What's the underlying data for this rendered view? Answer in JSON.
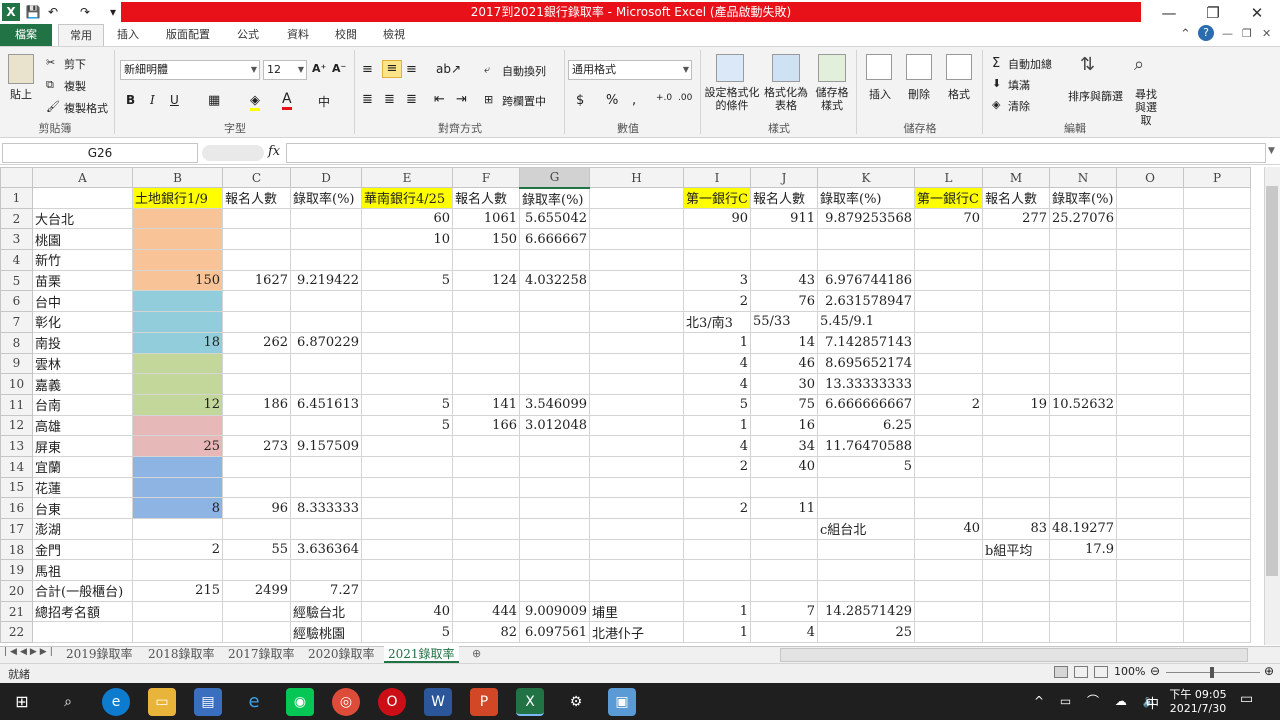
{
  "window": {
    "title": "2017到2021銀行錄取率 - Microsoft Excel (產品啟動失敗)",
    "controls": {
      "minimize": "—",
      "restore": "❐",
      "close": "✕"
    }
  },
  "ribbon_tabs": [
    "檔案",
    "常用",
    "插入",
    "版面配置",
    "公式",
    "資料",
    "校閱",
    "檢視"
  ],
  "ribbon": {
    "clipboard": {
      "paste": "貼上",
      "cut": "剪下",
      "copy": "複製",
      "format_painter": "複製格式",
      "label": "剪貼簿"
    },
    "font": {
      "name": "新細明體",
      "size": "12",
      "bold": "B",
      "italic": "I",
      "underline": "U",
      "label": "字型"
    },
    "alignment": {
      "wrap": "自動換列",
      "merge": "跨欄置中",
      "label": "對齊方式"
    },
    "number": {
      "format": "通用格式",
      "currency": "$",
      "percent": "%",
      "comma": ",",
      "label": "數值"
    },
    "styles": {
      "conditional": "設定格式化的條件",
      "table": "格式化為表格",
      "cell_styles": "儲存格樣式",
      "label": "樣式"
    },
    "cells": {
      "insert": "插入",
      "delete": "刪除",
      "format": "格式",
      "label": "儲存格"
    },
    "editing": {
      "autosum": "自動加總",
      "fill": "填滿",
      "clear": "清除",
      "sort": "排序與篩選",
      "find": "尋找與選取",
      "label": "編輯"
    }
  },
  "formula_bar": {
    "name_box": "G26",
    "fx": "fx",
    "value": ""
  },
  "columns": [
    "A",
    "B",
    "C",
    "D",
    "E",
    "F",
    "G",
    "H",
    "I",
    "J",
    "K",
    "L",
    "M",
    "N",
    "O",
    "P"
  ],
  "selected_column": "G",
  "rows": [
    {
      "n": "1",
      "cells": [
        "",
        "土地銀行1/9",
        "報名人數",
        "錄取率(%)",
        "華南銀行4/25",
        "報名人數",
        "錄取率(%)",
        "",
        "第一銀行C",
        "報名人數",
        "錄取率(%)",
        "第一銀行C",
        "報名人數",
        "錄取率(%)",
        "",
        ""
      ]
    },
    {
      "n": "2",
      "cells": [
        "大台北",
        "",
        "",
        "",
        "60",
        "1061",
        "5.655042",
        "",
        "90",
        "911",
        "9.879253568",
        "70",
        "277",
        "25.27076",
        "",
        ""
      ]
    },
    {
      "n": "3",
      "cells": [
        "桃園",
        "",
        "",
        "",
        "10",
        "150",
        "6.666667",
        "",
        "",
        "",
        "",
        "",
        "",
        "",
        "",
        ""
      ]
    },
    {
      "n": "4",
      "cells": [
        "新竹",
        "",
        "",
        "",
        "",
        "",
        "",
        "",
        "",
        "",
        "",
        "",
        "",
        "",
        "",
        ""
      ]
    },
    {
      "n": "5",
      "cells": [
        "苗栗",
        "150",
        "1627",
        "9.219422",
        "5",
        "124",
        "4.032258",
        "",
        "3",
        "43",
        "6.976744186",
        "",
        "",
        "",
        "",
        ""
      ]
    },
    {
      "n": "6",
      "cells": [
        "台中",
        "",
        "",
        "",
        "",
        "",
        "",
        "",
        "2",
        "76",
        "2.631578947",
        "",
        "",
        "",
        "",
        ""
      ]
    },
    {
      "n": "7",
      "cells": [
        "彰化",
        "",
        "",
        "",
        "",
        "",
        "",
        "",
        "北3/南3",
        "55/33",
        "5.45/9.1",
        "",
        "",
        "",
        "",
        ""
      ]
    },
    {
      "n": "8",
      "cells": [
        "南投",
        "18",
        "262",
        "6.870229",
        "",
        "",
        "",
        "",
        "1",
        "14",
        "7.142857143",
        "",
        "",
        "",
        "",
        ""
      ]
    },
    {
      "n": "9",
      "cells": [
        "雲林",
        "",
        "",
        "",
        "",
        "",
        "",
        "",
        "4",
        "46",
        "8.695652174",
        "",
        "",
        "",
        "",
        ""
      ]
    },
    {
      "n": "10",
      "cells": [
        "嘉義",
        "",
        "",
        "",
        "",
        "",
        "",
        "",
        "4",
        "30",
        "13.33333333",
        "",
        "",
        "",
        "",
        ""
      ]
    },
    {
      "n": "11",
      "cells": [
        "台南",
        "12",
        "186",
        "6.451613",
        "5",
        "141",
        "3.546099",
        "",
        "5",
        "75",
        "6.666666667",
        "2",
        "19",
        "10.52632",
        "",
        ""
      ]
    },
    {
      "n": "12",
      "cells": [
        "高雄",
        "",
        "",
        "",
        "5",
        "166",
        "3.012048",
        "",
        "1",
        "16",
        "6.25",
        "",
        "",
        "",
        "",
        ""
      ]
    },
    {
      "n": "13",
      "cells": [
        "屏東",
        "25",
        "273",
        "9.157509",
        "",
        "",
        "",
        "",
        "4",
        "34",
        "11.76470588",
        "",
        "",
        "",
        "",
        ""
      ]
    },
    {
      "n": "14",
      "cells": [
        "宜蘭",
        "",
        "",
        "",
        "",
        "",
        "",
        "",
        "2",
        "40",
        "5",
        "",
        "",
        "",
        "",
        ""
      ]
    },
    {
      "n": "15",
      "cells": [
        "花蓮",
        "",
        "",
        "",
        "",
        "",
        "",
        "",
        "",
        "",
        "",
        "",
        "",
        "",
        "",
        ""
      ]
    },
    {
      "n": "16",
      "cells": [
        "台東",
        "8",
        "96",
        "8.333333",
        "",
        "",
        "",
        "",
        "2",
        "11",
        "",
        "",
        "",
        "",
        "",
        ""
      ]
    },
    {
      "n": "17",
      "cells": [
        "澎湖",
        "",
        "",
        "",
        "",
        "",
        "",
        "",
        "",
        "",
        "c組台北",
        "40",
        "83",
        "48.19277",
        "",
        ""
      ]
    },
    {
      "n": "18",
      "cells": [
        "金門",
        "2",
        "55",
        "3.636364",
        "",
        "",
        "",
        "",
        "",
        "",
        "",
        "",
        "b組平均",
        "17.9",
        "",
        ""
      ]
    },
    {
      "n": "19",
      "cells": [
        "馬祖",
        "",
        "",
        "",
        "",
        "",
        "",
        "",
        "",
        "",
        "",
        "",
        "",
        "",
        "",
        ""
      ]
    },
    {
      "n": "20",
      "cells": [
        "合計(一般櫃台)",
        "215",
        "2499",
        "7.27",
        "",
        "",
        "",
        "",
        "",
        "",
        "",
        "",
        "",
        "",
        "",
        ""
      ]
    },
    {
      "n": "21",
      "cells": [
        "總招考名額",
        "",
        "",
        "經驗台北",
        "40",
        "444",
        "9.009009",
        "埔里",
        "1",
        "7",
        "14.28571429",
        "",
        "",
        "",
        "",
        ""
      ]
    },
    {
      "n": "22",
      "cells": [
        "",
        "",
        "",
        "經驗桃園",
        "5",
        "82",
        "6.097561",
        "北港仆子",
        "1",
        "4",
        "25",
        "",
        "",
        "",
        "",
        ""
      ]
    }
  ],
  "sheet_tabs": [
    "2019錄取率",
    "2018錄取率",
    "2017錄取率",
    "2020錄取率",
    "2021錄取率"
  ],
  "active_sheet": "2021錄取率",
  "status": {
    "ready": "就緒",
    "zoom": "100%"
  },
  "taskbar": {
    "time": "下午 09:05",
    "date": "2021/7/30",
    "ime": "中"
  },
  "colors": {
    "excel_green": "#217346",
    "title_red": "#e8111a",
    "yellow": "#ffff00"
  }
}
